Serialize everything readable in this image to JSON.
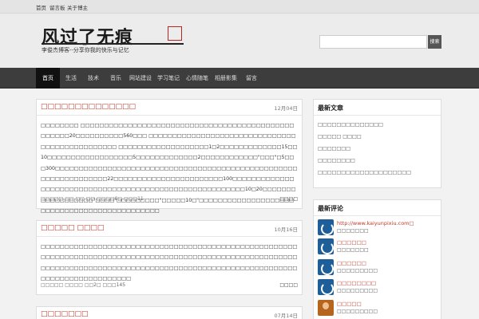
{
  "topbar": {
    "links": [
      "首页",
      "留言板",
      "关于博主"
    ]
  },
  "site": {
    "title": "风过了无痕",
    "subtitle": "李俊杰博客--分享你我的快乐与记忆",
    "seal": "印章"
  },
  "search": {
    "placeholder": "",
    "button": "搜索"
  },
  "nav": {
    "items": [
      "首页",
      "生活",
      "技术",
      "音乐",
      "网站建设",
      "学习笔记",
      "心情随笔",
      "相册影集",
      "留言"
    ]
  },
  "posts": [
    {
      "title": "□□□□□□□□□□□□□□",
      "date": "12月04日",
      "body": "□□□□□□□□ □□□□□□□□□□□□□□□□□□□□□□□□□□□□□□□□□□□□□□□□□□□□□□□□□□□20□□□□□□□□□□560□□□ □□□□□□□□□□□□□□□□□□□□□□□□□□□□□□□□□□□□□□□□□□□□□□□ □□□□□□□□□□□□□□□□□□□1□2□□□□□□□□□□□□□15□□10□□□□□□□□□□□□□□□□□□5□□□□□□□□□□□□□2□□□□□□□□□□□□\"□□□\"□5□□□300□□□□□□□□□□□□□□□□□□□□□□□□□□□□□□□□□□□□□□□□□□□□□□□□□□□□□□□□□□□□□□□□□22□□□□□□□□□□□□□□□□□□□□□□□100□□□□□□□□□□□□□□□□□□□□□□□□□□□□□□□□□□□□□□□□□□□□□□□□□□□□□□□□10□20□□□□□□□□□□□□□□□□□□\"□□□□\"□□□□□□□□□\"□□□□□10□\"□□□□□□□□□□□□□□□□□□□□□□□□□□□□□□□□□□□□□□□□□□□□□",
      "meta": "□□□□□ □□ □□ □□ □□□□0□ □□□11",
      "more": "□□□□"
    },
    {
      "title": "□□□□□ □□□□",
      "date": "10月16日",
      "body": "□□□□□□□□□□□□□□□□□□□□□□□□□□□□□□□□□□□□□□□□□□□□□□□□□□□□□□□□□□□□□□□□□□□□□□□□□□□□□□□□□□□□□□□□□□□□□□□□□□□□□□□□□□□□□□□□□□□□□□□□□□□□□□□□□□□□□□□□□□□□□□□□□□□□□□□□□□□□□□□□□□□□□□□□□□□□□□□□□□□□□",
      "meta": "□□□□□ □□□□ □□2□ □□□145",
      "more": "□□□□"
    },
    {
      "title": "□□□□□□□",
      "date": "07月14日",
      "body": "",
      "meta": "",
      "more": ""
    }
  ],
  "widgets": {
    "recent": {
      "title": "最新文章",
      "items": [
        "□□□□□□□□□□□□□□",
        "□□□□□ □□□□",
        "□□□□□□□",
        "□□□□□□□□",
        "□□□□□□□□□□□□□□□□□□□□"
      ]
    },
    "comments": {
      "title": "最新评论",
      "items": [
        {
          "name": "http://www.kaiyunpixiu.com□",
          "text": "□□□□□□□"
        },
        {
          "name": "□□□□□□",
          "text": "□□□□□□□"
        },
        {
          "name": "□□□□□□",
          "text": "□□□□□□□□□"
        },
        {
          "name": "□□□□□□□□",
          "text": "□□□□□□□□□"
        },
        {
          "name": "□□□□□",
          "text": "□□□□□□□□□"
        }
      ]
    }
  },
  "colors": {
    "accent": "#c0392b",
    "nav_bg": "#3d3d3d",
    "nav_active": "#111111",
    "avatar_blue": "#1f5f99"
  }
}
